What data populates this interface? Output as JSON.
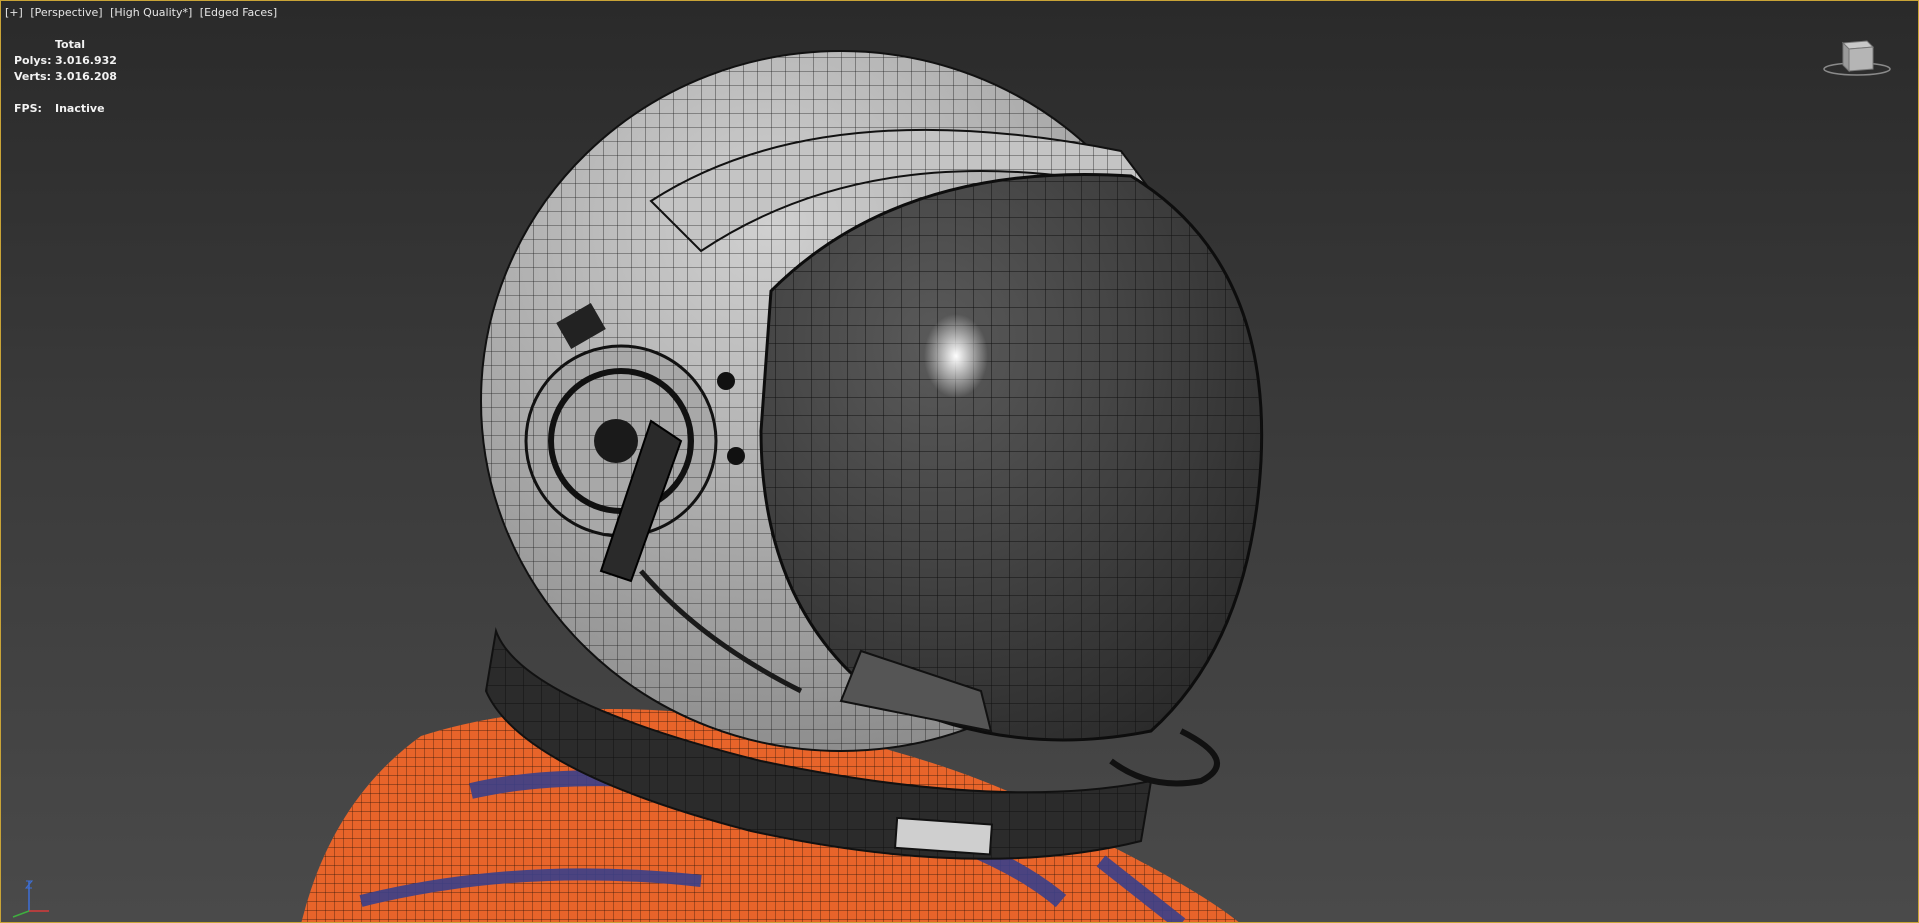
{
  "viewport": {
    "label_parts": [
      "[+]",
      "[Perspective]",
      "[High Quality*]",
      "[Edged Faces]"
    ],
    "stats": {
      "header": "Total",
      "polys_label": "Polys:",
      "polys_value": "3.016.932",
      "verts_label": "Verts:",
      "verts_value": "3.016.208",
      "fps_label": "FPS:",
      "fps_value": "Inactive"
    },
    "viewcube_icon": "viewcube-icon",
    "axis_icon": "xyz-axis-tripod-icon",
    "colors": {
      "viewport_border": "#c9a437",
      "suit_orange": "#e8642a",
      "suit_blue": "#3a3f8a",
      "helmet_shell": "#b9b9b9",
      "visor": "#3c3c3c"
    }
  }
}
